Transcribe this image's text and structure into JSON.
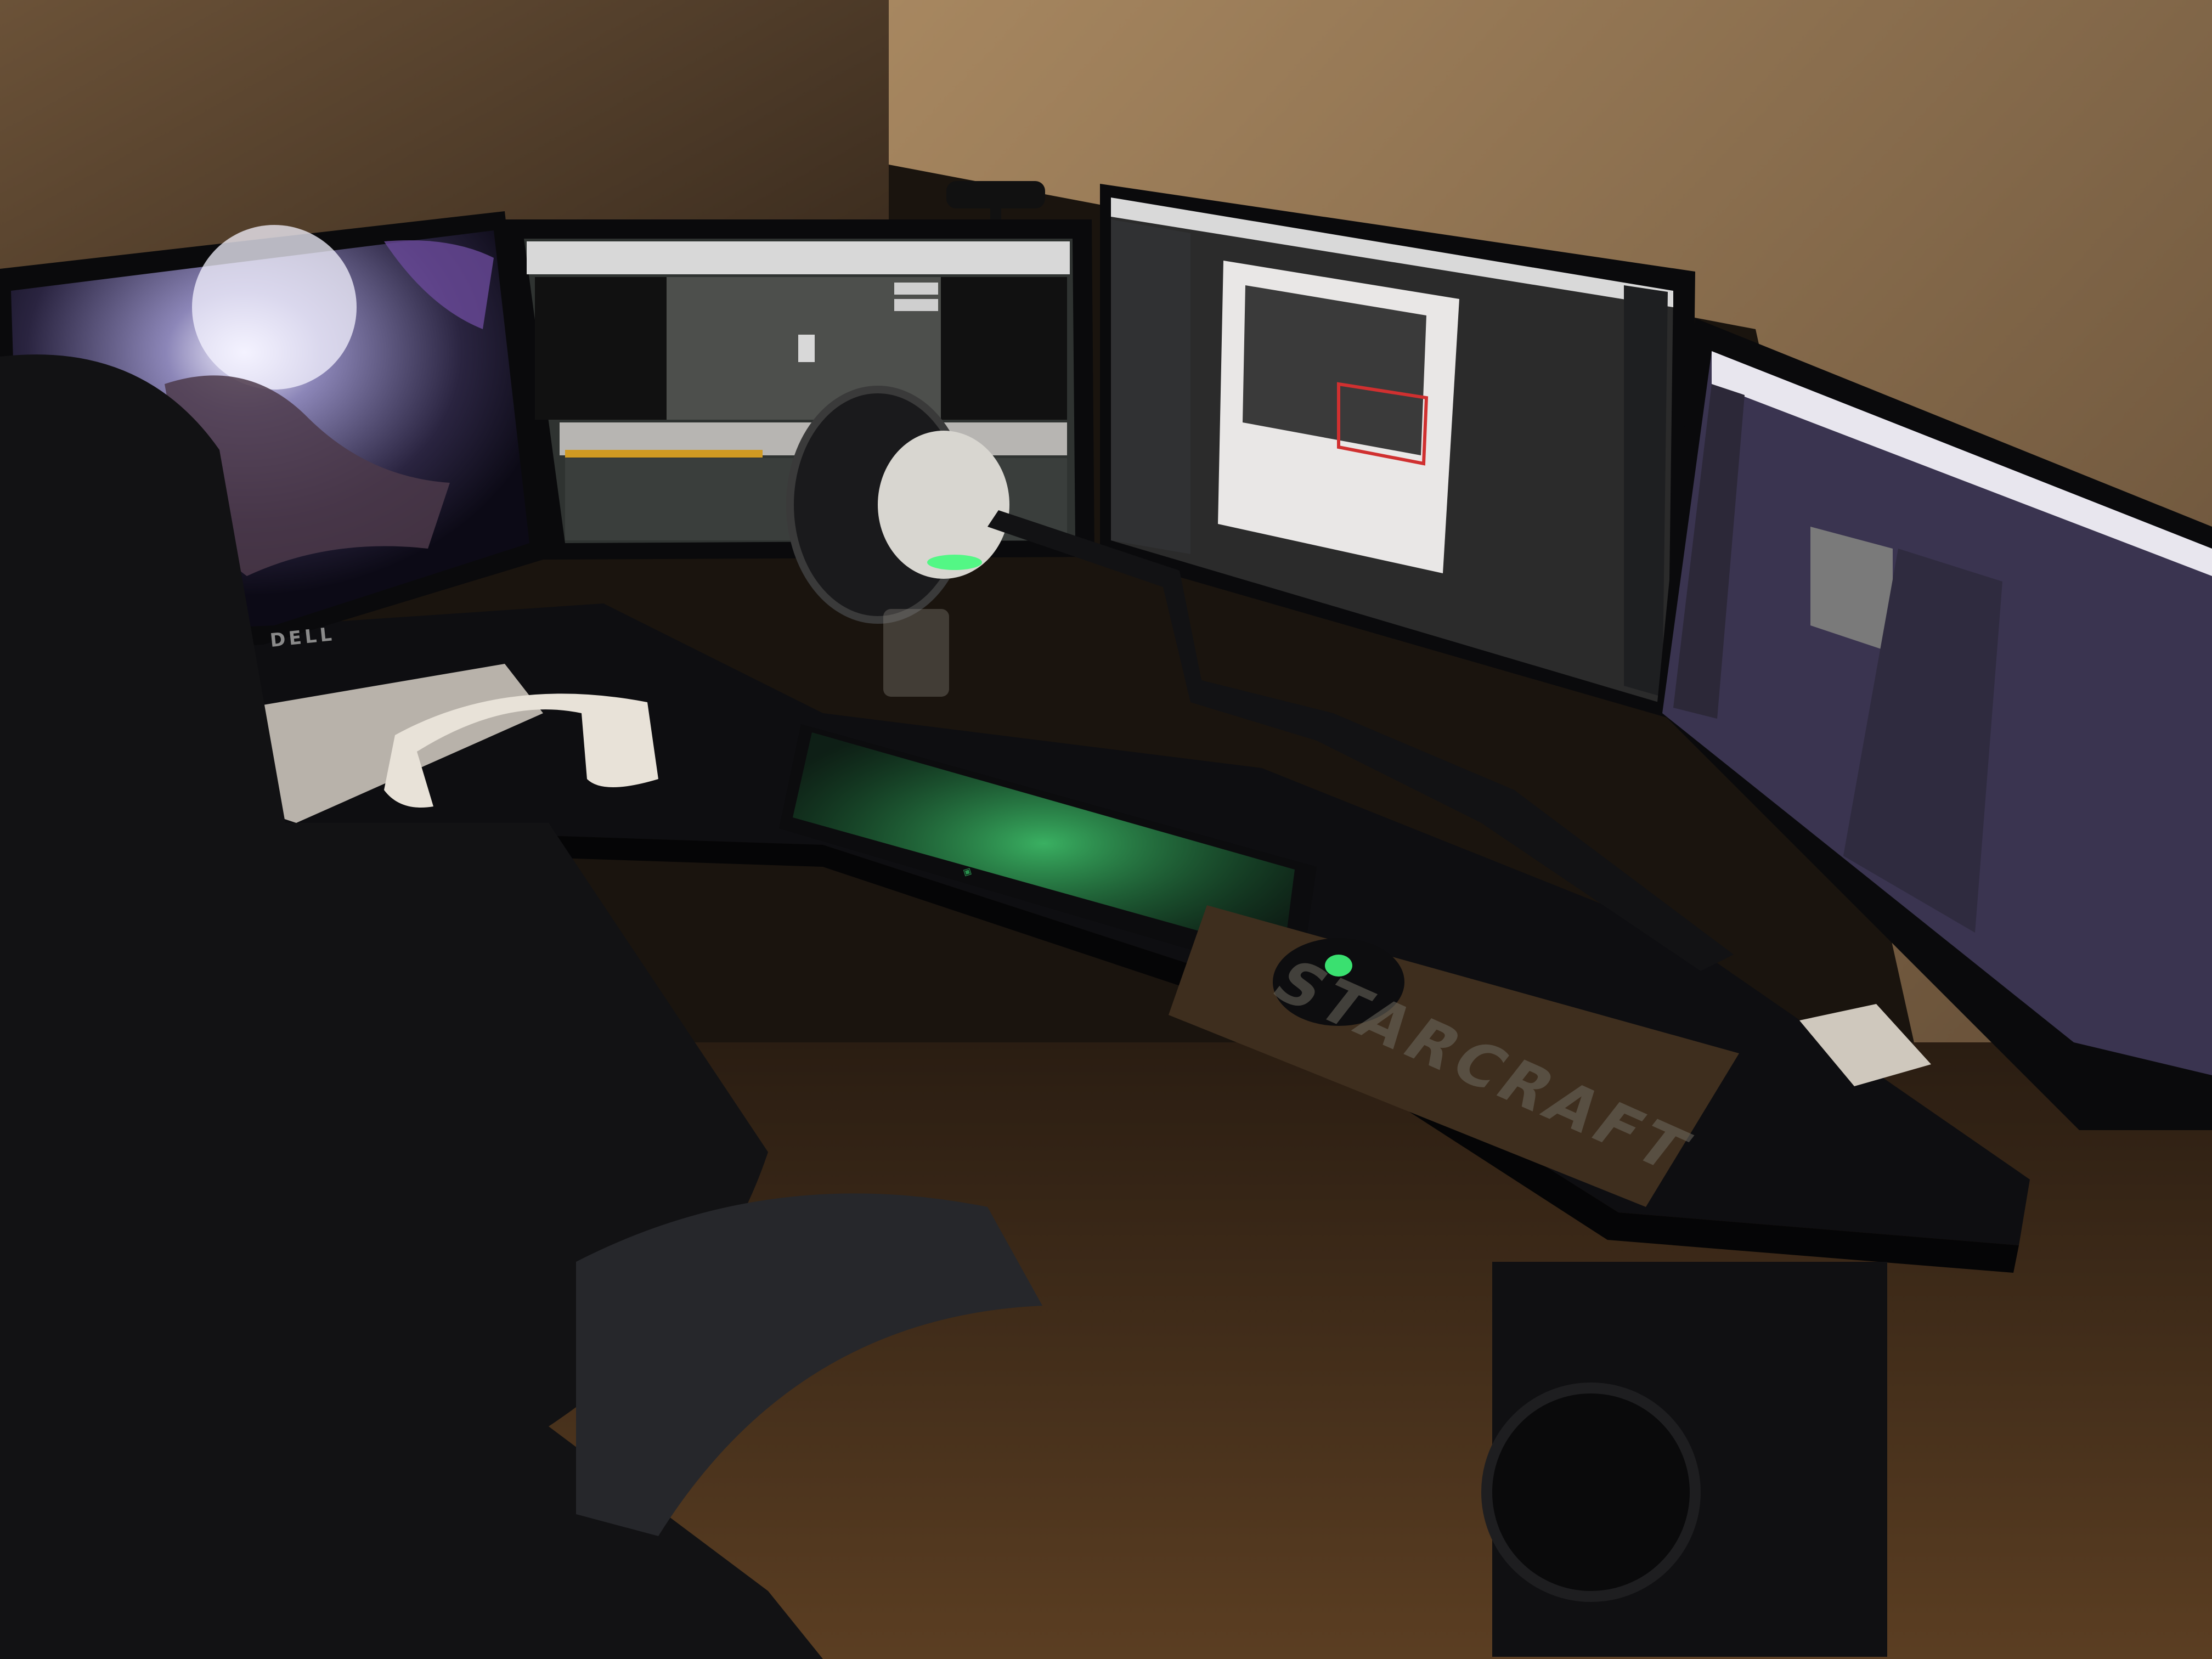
{
  "scene": {
    "subject": "gaming / streaming desk setup",
    "palette": {
      "wall": "#8a6d4a",
      "wall_dark": "#3a2c1f",
      "desk": "#0d0d0f",
      "keyboard_glow": "#38e070",
      "screen_purple": "#3a3450",
      "screen_dark": "#2b2b2b"
    }
  },
  "monitors": [
    {
      "name": "left monitor",
      "content": "space wallpaper",
      "brand": "DELL"
    },
    {
      "name": "center-left monitor",
      "content": "streaming software preview"
    },
    {
      "name": "center-right monitor",
      "content": "code editor with video preview"
    },
    {
      "name": "right monitor",
      "content": "chat dashboard"
    }
  ],
  "peripherals": {
    "keyboard": {
      "brand_logo": "razer-logo-icon",
      "backlight": "#38e070"
    },
    "mouse": {
      "brand_logo": "razer-logo-icon"
    },
    "mousepad": {
      "logo_text": "STARCRAFT"
    },
    "headset": {
      "color": "#e8e2d8"
    },
    "microphone": {
      "accessory": "pop filter on boom arm"
    }
  },
  "labels": {
    "dell": "DELL",
    "mousepad": "STARCRAFT"
  }
}
